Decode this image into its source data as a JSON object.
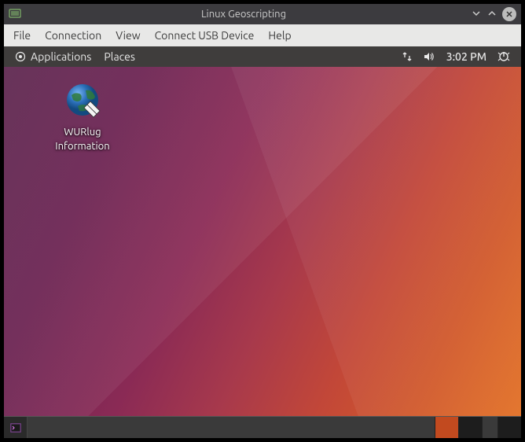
{
  "window": {
    "title": "Linux Geoscripting"
  },
  "vm_menu": {
    "file": "File",
    "connection": "Connection",
    "view": "View",
    "connect_usb": "Connect USB Device",
    "help": "Help"
  },
  "guest_panel": {
    "applications": "Applications",
    "places": "Places",
    "time": "3:02 PM"
  },
  "desktop": {
    "icon1_line1": "WURlug",
    "icon1_line2": "Information"
  }
}
